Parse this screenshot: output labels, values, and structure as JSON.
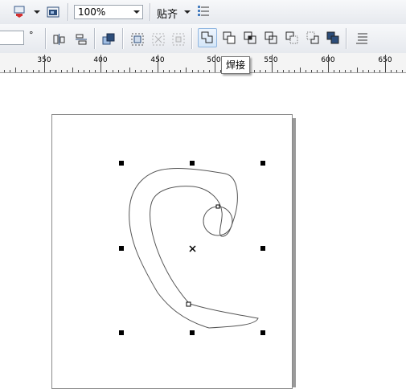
{
  "toolbar": {
    "zoom_value": "100%",
    "snap_label": "贴齐",
    "coord_label": "°"
  },
  "ruler": {
    "labels": [
      "350",
      "400",
      "450",
      "500",
      "550",
      "600",
      "650"
    ]
  },
  "tooltip": {
    "text": "焊接"
  },
  "icons": {
    "toolbar1": [
      "export-icon",
      "dropdown-arrow-icon",
      "app-launcher-icon",
      "zoom-dropdown-arrow-icon",
      "snap-dropdown-arrow-icon",
      "options-icon"
    ],
    "toolbar2": [
      "align-icon",
      "distribute-icon",
      "order-icon",
      "group-icon",
      "ungroup-icon",
      "ungroup-all-icon",
      "weld-icon",
      "trim-icon",
      "intersect-icon",
      "simplify-icon",
      "front-minus-back-icon",
      "back-minus-front-icon",
      "boundary-icon",
      "hint-options-icon"
    ]
  },
  "colors": {
    "toolbar_bg": "#e6e9ee",
    "active_button_border": "#8fb5e0",
    "selection_handle": "#000000",
    "page_shadow": "#9a9a9a"
  }
}
